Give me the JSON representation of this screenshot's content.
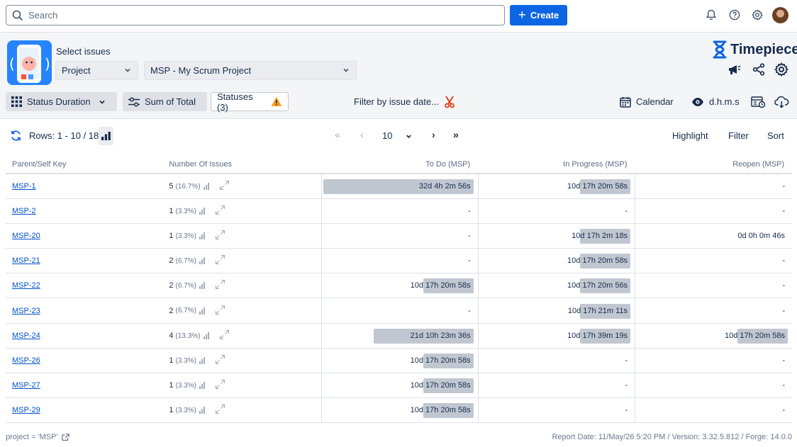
{
  "topbar": {
    "search_placeholder": "Search",
    "create_label": "Create"
  },
  "header": {
    "select_issues_label": "Select issues",
    "scope_select": "Project",
    "project_select": "MSP - My Scrum Project",
    "brand": "Timepiece"
  },
  "toolbar": {
    "status_duration": "Status Duration",
    "sum_of_total": "Sum of Total",
    "statuses": "Statuses (3)",
    "filter_by_date": "Filter by issue date...",
    "calendar": "Calendar",
    "time_format": "d.h.m.s"
  },
  "pager": {
    "rows_info": "Rows: 1 - 10 / 18",
    "page_size": "10",
    "highlight": "Highlight",
    "filter": "Filter",
    "sort": "Sort"
  },
  "table": {
    "columns": [
      "Parent/Self Key",
      "Number Of Issues",
      "To Do (MSP)",
      "In Progress (MSP)",
      "Reopen (MSP)"
    ],
    "rows": [
      {
        "key": "MSP-1",
        "count": "5",
        "pct": "(16.7%)",
        "todo": "32d 4h 2m 56s",
        "todo_fill": 1.0,
        "inprog": "10d 17h 20m 58s",
        "inprog_fill": 0.333,
        "reopen": "-",
        "reopen_fill": 0
      },
      {
        "key": "MSP-2",
        "count": "1",
        "pct": "(3.3%)",
        "todo": "-",
        "todo_fill": 0,
        "inprog": "-",
        "inprog_fill": 0,
        "reopen": "-",
        "reopen_fill": 0
      },
      {
        "key": "MSP-20",
        "count": "1",
        "pct": "(3.3%)",
        "todo": "-",
        "todo_fill": 0,
        "inprog": "10d 17h 2m 18s",
        "inprog_fill": 0.331,
        "reopen": "0d 0h 0m 46s",
        "reopen_fill": 0
      },
      {
        "key": "MSP-21",
        "count": "2",
        "pct": "(6.7%)",
        "todo": "-",
        "todo_fill": 0,
        "inprog": "10d 17h 20m 58s",
        "inprog_fill": 0.333,
        "reopen": "-",
        "reopen_fill": 0
      },
      {
        "key": "MSP-22",
        "count": "2",
        "pct": "(6.7%)",
        "todo": "10d 17h 20m 58s",
        "todo_fill": 0.333,
        "inprog": "10d 17h 20m 56s",
        "inprog_fill": 0.333,
        "reopen": "-",
        "reopen_fill": 0
      },
      {
        "key": "MSP-23",
        "count": "2",
        "pct": "(6.7%)",
        "todo": "-",
        "todo_fill": 0,
        "inprog": "10d 17h 21m 11s",
        "inprog_fill": 0.333,
        "reopen": "-",
        "reopen_fill": 0
      },
      {
        "key": "MSP-24",
        "count": "4",
        "pct": "(13.3%)",
        "todo": "21d 10h 23m 36s",
        "todo_fill": 0.665,
        "inprog": "10d 17h 39m 19s",
        "inprog_fill": 0.334,
        "reopen": "10d 17h 20m 58s",
        "reopen_fill": 0.333
      },
      {
        "key": "MSP-26",
        "count": "1",
        "pct": "(3.3%)",
        "todo": "10d 17h 20m 58s",
        "todo_fill": 0.333,
        "inprog": "-",
        "inprog_fill": 0,
        "reopen": "-",
        "reopen_fill": 0
      },
      {
        "key": "MSP-27",
        "count": "1",
        "pct": "(3.3%)",
        "todo": "10d 17h 20m 58s",
        "todo_fill": 0.333,
        "inprog": "-",
        "inprog_fill": 0,
        "reopen": "-",
        "reopen_fill": 0
      },
      {
        "key": "MSP-29",
        "count": "1",
        "pct": "(3.3%)",
        "todo": "10d 17h 20m 58s",
        "todo_fill": 0.333,
        "inprog": "-",
        "inprog_fill": 0,
        "reopen": "-",
        "reopen_fill": 0
      }
    ]
  },
  "footer": {
    "query": "project = 'MSP'",
    "report_info": "Report Date: 11/May/26 5:20 PM / Version: 3.32.5.812 / Forge: 14.0.0"
  },
  "colors": {
    "accent": "#0c66e4",
    "bar": "#c1c7d0",
    "link": "#0052cc",
    "warning": "#ff991f",
    "filter_icon": "#de350b"
  }
}
